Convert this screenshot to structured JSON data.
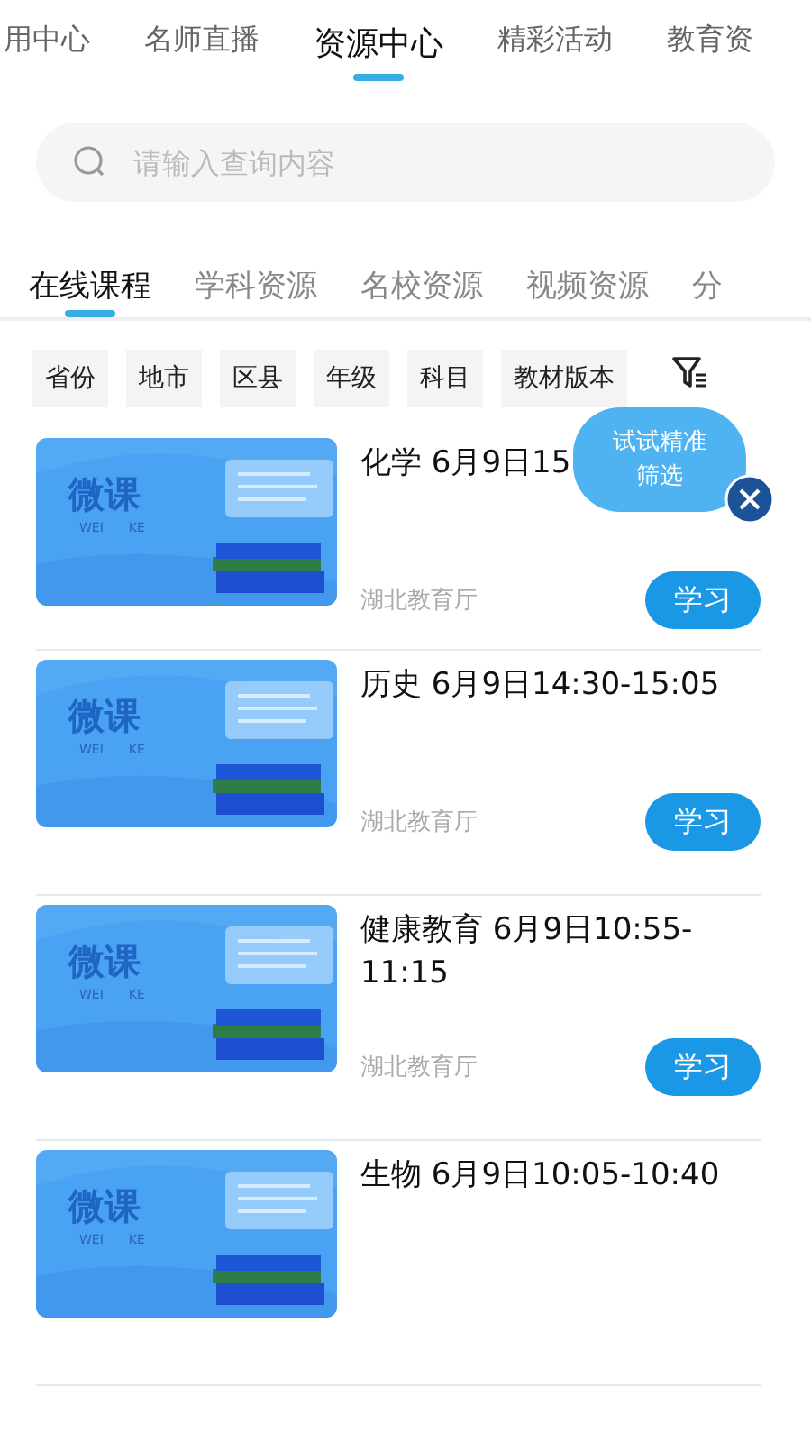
{
  "top_tabs": [
    {
      "label": "用中心",
      "selected": false
    },
    {
      "label": "名师直播",
      "selected": false
    },
    {
      "label": "资源中心",
      "selected": true
    },
    {
      "label": "精彩活动",
      "selected": false
    },
    {
      "label": "教育资",
      "selected": false
    }
  ],
  "search": {
    "placeholder": "请输入查询内容"
  },
  "sub_tabs": [
    {
      "label": "在线课程",
      "selected": true
    },
    {
      "label": "学科资源",
      "selected": false
    },
    {
      "label": "名校资源",
      "selected": false
    },
    {
      "label": "视频资源",
      "selected": false
    },
    {
      "label": "分",
      "selected": false
    }
  ],
  "filters": [
    "省份",
    "地市",
    "区县",
    "年级",
    "科目",
    "教材版本"
  ],
  "tip": {
    "text": "试试精准筛选"
  },
  "courses": [
    {
      "thumb": {
        "title": "微课",
        "sub": [
          "WEI",
          "KE"
        ]
      },
      "title": "化学 6月9日15",
      "source": "湖北教育厅",
      "button": "学习"
    },
    {
      "thumb": {
        "title": "微课",
        "sub": [
          "WEI",
          "KE"
        ]
      },
      "title": "历史 6月9日14:30-15:05",
      "source": "湖北教育厅",
      "button": "学习"
    },
    {
      "thumb": {
        "title": "微课",
        "sub": [
          "WEI",
          "KE"
        ]
      },
      "title": "健康教育 6月9日10:55-11:15",
      "source": "湖北教育厅",
      "button": "学习"
    },
    {
      "thumb": {
        "title": "微课",
        "sub": [
          "WEI",
          "KE"
        ]
      },
      "title": "生物 6月9日10:05-10:40"
    }
  ]
}
